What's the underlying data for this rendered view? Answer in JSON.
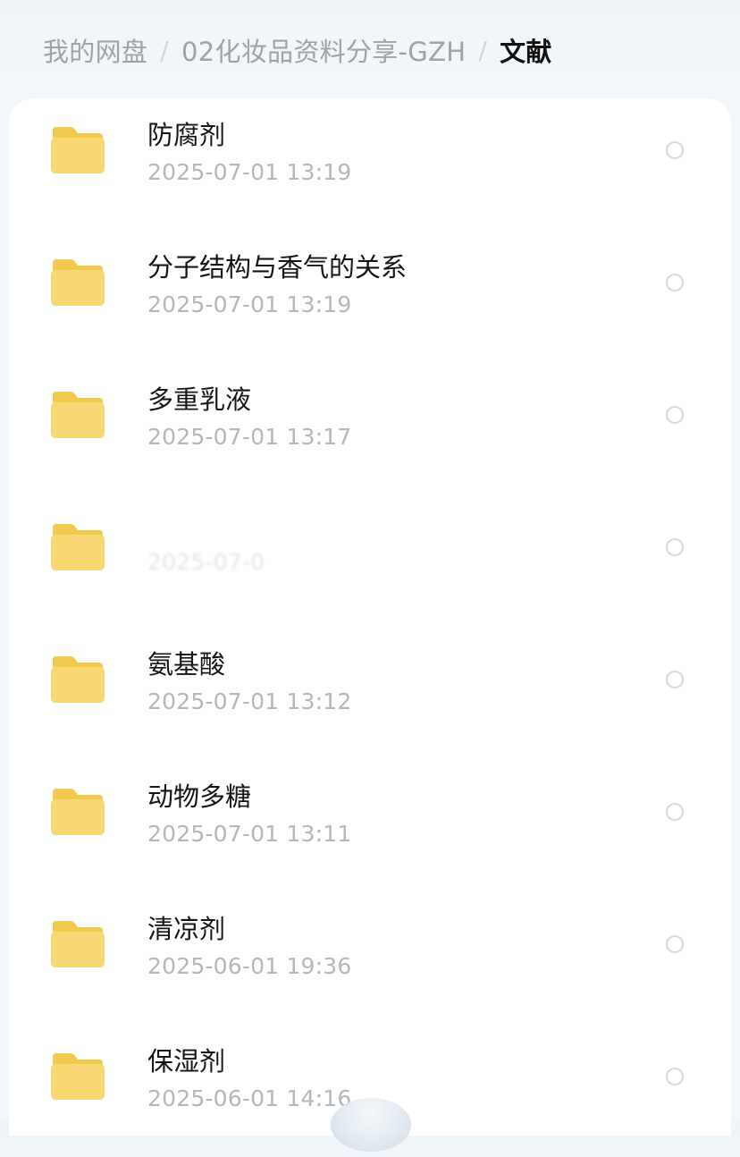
{
  "breadcrumb": {
    "root": "我的网盘",
    "parent": "02化妆品资料分享-GZH",
    "current": "文献",
    "separator": "/"
  },
  "colors": {
    "folder_fill": "#f7d873",
    "folder_tab": "#f2c94f",
    "time_text": "#b3b7bb",
    "radio_border": "#d6d9dc"
  },
  "files": [
    {
      "name": "防腐剂",
      "time": "2025-07-01  13:19",
      "icon": "folder-icon"
    },
    {
      "name": "分子结构与香气的关系",
      "time": "2025-07-01  13:19",
      "icon": "folder-icon"
    },
    {
      "name": "多重乳液",
      "time": "2025-07-01  13:17",
      "icon": "folder-icon"
    },
    {
      "name": "",
      "time": "2025-07-0",
      "icon": "folder-icon"
    },
    {
      "name": "氨基酸",
      "time": "2025-07-01  13:12",
      "icon": "folder-icon"
    },
    {
      "name": "动物多糖",
      "time": "2025-07-01  13:11",
      "icon": "folder-icon"
    },
    {
      "name": "清凉剂",
      "time": "2025-06-01  19:36",
      "icon": "folder-icon"
    },
    {
      "name": "保湿剂",
      "time": "2025-06-01  14:16",
      "icon": "folder-icon"
    }
  ]
}
